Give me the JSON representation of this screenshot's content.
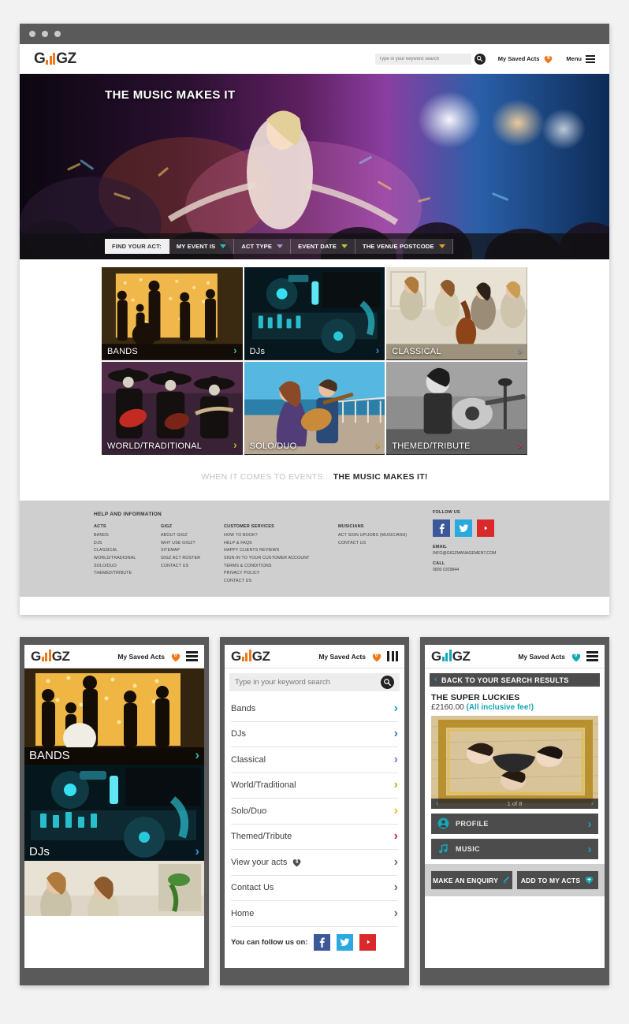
{
  "header": {
    "logo": {
      "left": "G",
      "right": "GZ"
    },
    "search_placeholder": "Type in your keyword search",
    "saved_acts_label": "My Saved Acts",
    "saved_acts_count": "0",
    "menu_label": "Menu"
  },
  "hero": {
    "title": "THE MUSIC MAKES IT",
    "filters": [
      {
        "label": "FIND YOUR ACT:",
        "chev": false,
        "chev_color": ""
      },
      {
        "label": "MY EVENT IS",
        "chev": true,
        "chev_color": "#35b5b8"
      },
      {
        "label": "ACT TYPE",
        "chev": true,
        "chev_color": "#9b9bd0"
      },
      {
        "label": "EVENT DATE",
        "chev": true,
        "chev_color": "#b6c62e"
      },
      {
        "label": "THE VENUE POSTCODE",
        "chev": true,
        "chev_color": "#e2a02a"
      }
    ]
  },
  "tiles": [
    {
      "label": "BANDS",
      "chev_color": "#35b5b8"
    },
    {
      "label": "DJs",
      "chev_color": "#3a8fd6"
    },
    {
      "label": "CLASSICAL",
      "chev_color": "#8f8fd8"
    },
    {
      "label": "WORLD/TRADITIONAL",
      "chev_color": "#b6c62e"
    },
    {
      "label": "SOLO/DUO",
      "chev_color": "#e9b71b"
    },
    {
      "label": "THEMED/TRIBUTE",
      "chev_color": "#d6386b"
    }
  ],
  "tagline": {
    "grey": "WHEN IT COMES TO EVENTS...",
    "dark": "THE MUSIC MAKES IT!"
  },
  "footer": {
    "heading": "HELP AND INFORMATION",
    "columns": [
      {
        "head": "ACTS",
        "items": [
          "BANDS",
          "DJS",
          "CLASSICAL",
          "WORLD/TRADIONAL",
          "SOLO/DUO",
          "THEMED/TRIBUTE"
        ]
      },
      {
        "head": "GIGZ",
        "items": [
          "ABOUT GIGZ",
          "WHY USE GIGZ?",
          "SITEMAP",
          "GIGZ ACT ROSTER",
          "CONTACT US"
        ]
      },
      {
        "head": "CUSTOMER SERVICES",
        "items": [
          "HOW TO BOOK?",
          "HELP & FAQS",
          "HAPPY CLIENTS REVIEWS",
          "SIGN-IN TO YOUR CUSTOMER ACCOUNT",
          "TERMS & CONDITIONS",
          "PRIVACY POLICY",
          "CONTACT US"
        ]
      },
      {
        "head": "MUSICIANS",
        "items": [
          "ACT SIGN UP/JOBS (MUSICIANS)",
          "CONTACT US"
        ]
      }
    ],
    "follow_heading": "FOLLOW US",
    "email_label": "EMAIL",
    "email_value": "INFO@GIGZMANAGEMENT.COM",
    "call_label": "CALL",
    "call_value": "0800 0329844"
  },
  "phone1": {
    "logo": {
      "left": "G",
      "right": "GZ"
    },
    "saved_acts_label": "My Saved Acts",
    "saved_acts_count": "0",
    "tiles": [
      {
        "label": "BANDS",
        "chev_color": "#35b5b8"
      },
      {
        "label": "DJs",
        "chev_color": "#3a8fd6"
      }
    ]
  },
  "phone2": {
    "logo": {
      "left": "G",
      "right": "GZ"
    },
    "saved_acts_label": "My Saved Acts",
    "saved_acts_count": "0",
    "search_placeholder": "Type in your keyword search",
    "menu": [
      {
        "label": "Bands",
        "chev_color": "#16a6b6",
        "badge": ""
      },
      {
        "label": "DJs",
        "chev_color": "#2b7fd4",
        "badge": ""
      },
      {
        "label": "Classical",
        "chev_color": "#7b7bd0",
        "badge": ""
      },
      {
        "label": "World/Traditional",
        "chev_color": "#a7bb28",
        "badge": ""
      },
      {
        "label": "Solo/Duo",
        "chev_color": "#e9b71b",
        "badge": ""
      },
      {
        "label": "Themed/Tribute",
        "chev_color": "#c4245c",
        "badge": ""
      },
      {
        "label": "View your acts",
        "chev_color": "#6d6d6d",
        "badge": "6"
      },
      {
        "label": "Contact Us",
        "chev_color": "#6d6d6d",
        "badge": ""
      },
      {
        "label": "Home",
        "chev_color": "#6d6d6d",
        "badge": ""
      }
    ],
    "follow_label": "You can follow us on:"
  },
  "phone3": {
    "logo": {
      "left": "G",
      "right": "GZ"
    },
    "saved_acts_label": "My Saved Acts",
    "saved_acts_count": "0",
    "back_label": "BACK TO YOUR SEARCH RESULTS",
    "act_name": "THE SUPER LUCKIES",
    "price": "£2160.00",
    "price_note": "(All inclusive fee!)",
    "gallery_counter": "1 of 8",
    "rows": [
      {
        "label": "PROFILE",
        "icon": "person-icon"
      },
      {
        "label": "MUSIC",
        "icon": "music-note-icon"
      }
    ],
    "cta_enquiry": "MAKE AN ENQUIRY",
    "cta_add": "ADD TO MY ACTS"
  },
  "colors": {
    "accent_orange": "#ec7a1c",
    "accent_teal": "#16a6b6"
  }
}
